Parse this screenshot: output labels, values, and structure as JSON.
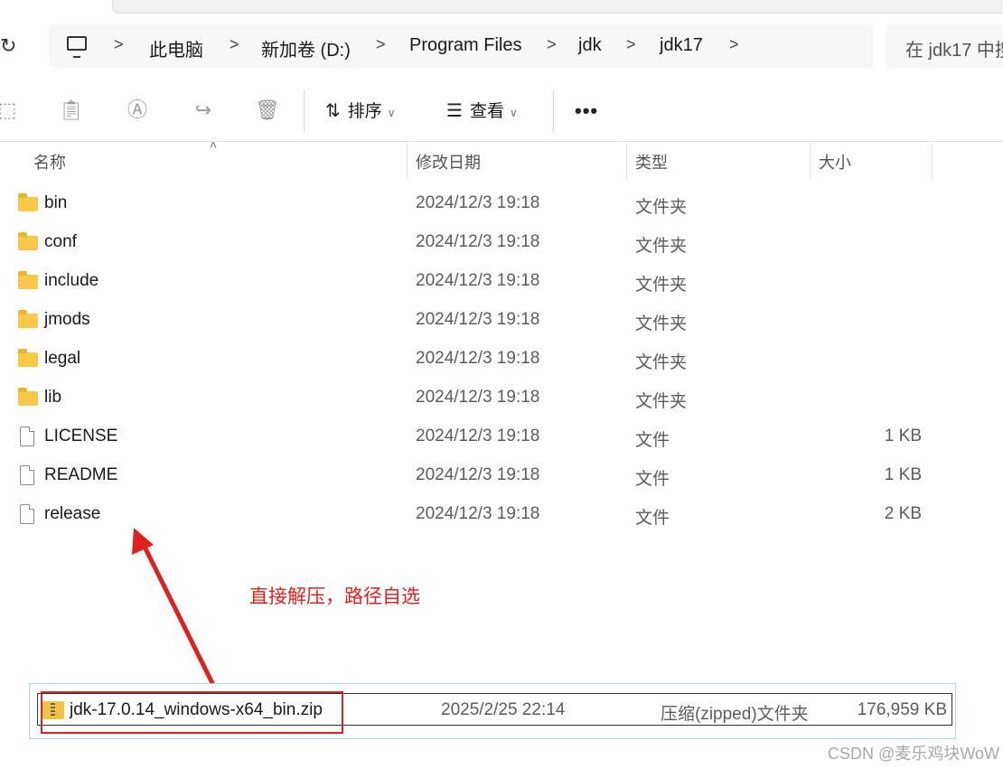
{
  "address": {
    "refresh_icon": "refresh-icon",
    "breadcrumbs": [
      "此电脑",
      "新加卷 (D:)",
      "Program Files",
      "jdk",
      "jdk17"
    ],
    "separator": ">",
    "search_placeholder": "在 jdk17 中搜"
  },
  "toolbar": {
    "icons": [
      "new-icon",
      "paste-icon",
      "rename-icon",
      "share-icon",
      "delete-icon"
    ],
    "sort_label": "排序",
    "view_label": "查看",
    "more_label": "•••"
  },
  "columns": {
    "name": "名称",
    "date": "修改日期",
    "type": "类型",
    "size": "大小"
  },
  "files": [
    {
      "name": "bin",
      "date": "2024/12/3 19:18",
      "type": "文件夹",
      "size": "",
      "kind": "folder"
    },
    {
      "name": "conf",
      "date": "2024/12/3 19:18",
      "type": "文件夹",
      "size": "",
      "kind": "folder"
    },
    {
      "name": "include",
      "date": "2024/12/3 19:18",
      "type": "文件夹",
      "size": "",
      "kind": "folder"
    },
    {
      "name": "jmods",
      "date": "2024/12/3 19:18",
      "type": "文件夹",
      "size": "",
      "kind": "folder"
    },
    {
      "name": "legal",
      "date": "2024/12/3 19:18",
      "type": "文件夹",
      "size": "",
      "kind": "folder"
    },
    {
      "name": "lib",
      "date": "2024/12/3 19:18",
      "type": "文件夹",
      "size": "",
      "kind": "folder"
    },
    {
      "name": "LICENSE",
      "date": "2024/12/3 19:18",
      "type": "文件",
      "size": "1 KB",
      "kind": "file"
    },
    {
      "name": "README",
      "date": "2024/12/3 19:18",
      "type": "文件",
      "size": "1 KB",
      "kind": "file"
    },
    {
      "name": "release",
      "date": "2024/12/3 19:18",
      "type": "文件",
      "size": "2 KB",
      "kind": "file"
    }
  ],
  "annotation": {
    "text": "直接解压，路径自选",
    "color": "#e02020"
  },
  "zipfile": {
    "name": "jdk-17.0.14_windows-x64_bin.zip",
    "date": "2025/2/25 22:14",
    "type": "压缩(zipped)文件夹",
    "size": "176,959 KB"
  },
  "watermark": "CSDN @麦乐鸡块WoW"
}
